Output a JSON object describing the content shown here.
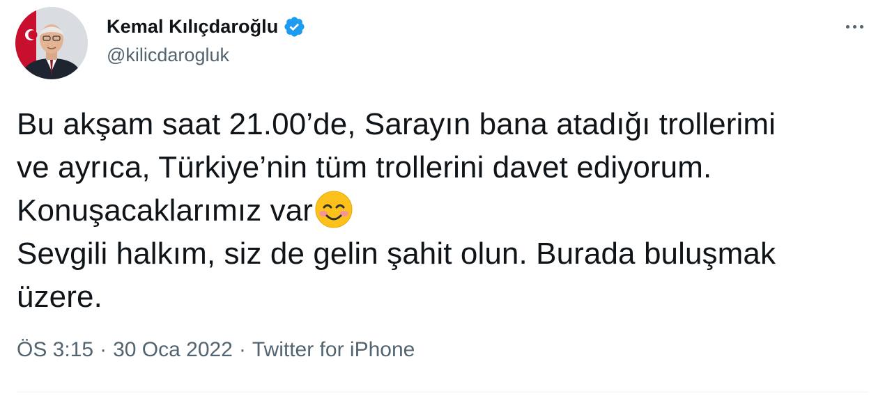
{
  "author": {
    "display_name": "Kemal Kılıçdaroğlu",
    "handle": "@kilicdarogluk",
    "verified_icon": "verified-badge-icon",
    "avatar": "profile-photo"
  },
  "tweet": {
    "lines": [
      "Bu akşam saat 21.00’de, Sarayın bana atadığı trollerimi",
      "ve ayrıca, Türkiye’nin tüm trollerini davet ediyorum.",
      "Konuşacaklarımız var",
      "Sevgili halkım, siz de gelin şahit olun. Burada buluşmak",
      "üzere."
    ],
    "emoji": "smiling-face-with-smiling-eyes"
  },
  "meta": {
    "time": "ÖS 3:15",
    "separator": "·",
    "date": "30 Oca 2022",
    "source": "Twitter for iPhone"
  },
  "menu": {
    "icon": "more-options-icon"
  },
  "colors": {
    "primary_text": "#0f1419",
    "secondary_text": "#536471",
    "verified_blue": "#1d9bf0",
    "divider": "#eff3f4"
  }
}
